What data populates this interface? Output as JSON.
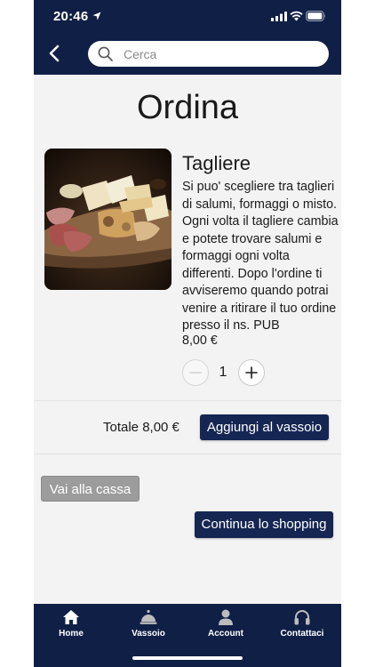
{
  "status_bar": {
    "time": "20:46"
  },
  "header": {
    "search_placeholder": "Cerca"
  },
  "page": {
    "title": "Ordina"
  },
  "product": {
    "name": "Tagliere",
    "description": "Si puo' scegliere tra taglieri di salumi, formaggi o misto. Ogni volta il tagliere cambia e potete trovare salumi e formaggi ogni volta differenti. Dopo l'ordine ti avviseremo quando potrai venire a ritirare il tuo ordine presso il ns. PUB",
    "price": "8,00 €",
    "quantity": "1"
  },
  "cart": {
    "total_label": "Totale 8,00 €",
    "add_button": "Aggiungi al vassoio"
  },
  "actions": {
    "checkout_button": "Vai alla cassa",
    "continue_button": "Continua lo shopping"
  },
  "tabbar": {
    "items": [
      {
        "label": "Home",
        "icon": "home-icon"
      },
      {
        "label": "Vassoio",
        "icon": "cloche-icon"
      },
      {
        "label": "Account",
        "icon": "person-icon"
      },
      {
        "label": "Contattaci",
        "icon": "headphones-icon"
      }
    ]
  },
  "colors": {
    "navy": "#0f1f46",
    "button_navy": "#152653",
    "gray_button": "#9c9c9c",
    "background": "#f3f3f3"
  }
}
